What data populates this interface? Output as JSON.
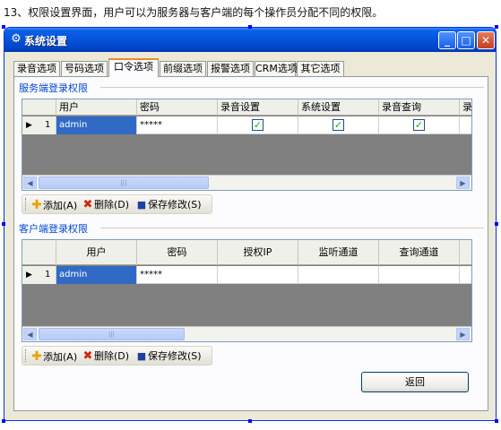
{
  "caption": "13、权限设置界面，用户可以为服务器与客户端的每个操作员分配不同的权限。",
  "window": {
    "title": "系统设置",
    "icon": "gear-icon",
    "controls": {
      "minimize": "_",
      "maximize": "□",
      "close": "✕"
    }
  },
  "tabs": [
    {
      "label": "录音选项",
      "active": false
    },
    {
      "label": "号码选项",
      "active": false
    },
    {
      "label": "口令选项",
      "active": true
    },
    {
      "label": "前缀选项",
      "active": false
    },
    {
      "label": "报警选项",
      "active": false
    },
    {
      "label": "CRM选项",
      "active": false
    },
    {
      "label": "其它选项",
      "active": false
    }
  ],
  "server_group": {
    "label": "服务端登录权限",
    "columns": [
      "用户",
      "密码",
      "录音设置",
      "系统设置",
      "录音查询",
      "录"
    ],
    "row": {
      "marker": "▶",
      "num": "1",
      "user": "admin",
      "password": "*****",
      "checks": [
        true,
        true,
        true
      ]
    },
    "scrollbar": {
      "left": "◀",
      "right": "▶",
      "thumb": "|||"
    },
    "toolbar": {
      "add": "添加(A)",
      "delete": "删除(D)",
      "save": "保存修改(S)"
    }
  },
  "client_group": {
    "label": "客户端登录权限",
    "columns": [
      "用户",
      "密码",
      "授权IP",
      "监听通道",
      "查询通道"
    ],
    "row": {
      "marker": "▶",
      "num": "1",
      "user": "admin",
      "password": "*****"
    },
    "scrollbar": {
      "left": "◀",
      "right": "▶",
      "thumb": "|||"
    },
    "toolbar": {
      "add": "添加(A)",
      "delete": "删除(D)",
      "save": "保存修改(S)"
    }
  },
  "back_button": "返回",
  "colors": {
    "title_bar": "#0653d9",
    "tab_accent": "#e68b2c",
    "group_label": "#0046d5",
    "selection": "#316ac5"
  }
}
